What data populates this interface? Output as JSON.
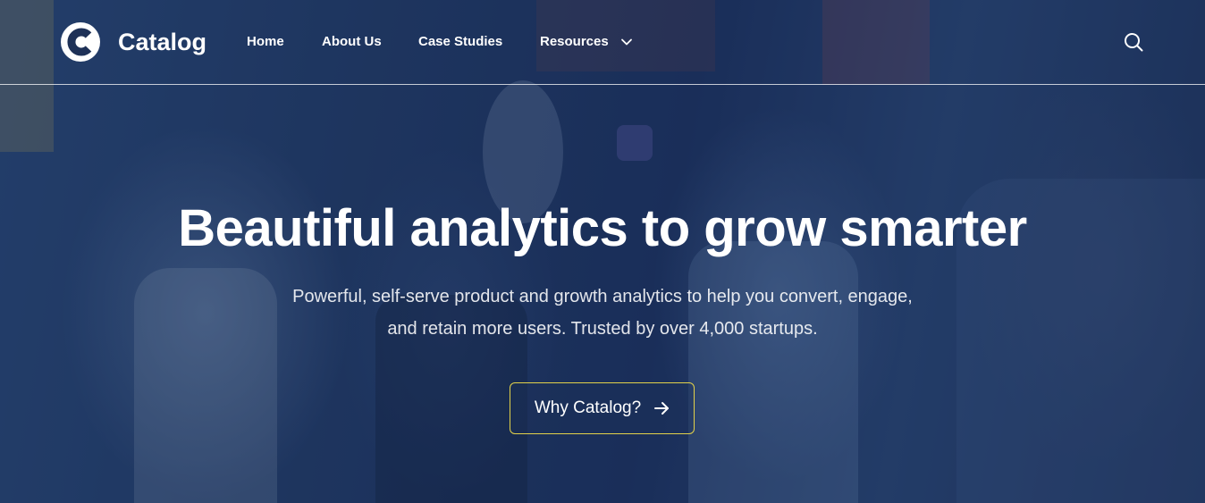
{
  "brand": {
    "name": "Catalog",
    "logo_icon": "catalog-c-logo"
  },
  "nav": {
    "items": [
      {
        "label": "Home"
      },
      {
        "label": "About Us"
      },
      {
        "label": "Case Studies"
      },
      {
        "label": "Resources",
        "has_dropdown": true,
        "icon": "chevron-down-icon"
      }
    ],
    "search_icon": "search-icon"
  },
  "hero": {
    "title": "Beautiful analytics to grow smarter",
    "subtitle_line1": "Powerful, self-serve product and growth analytics to help you convert, engage,",
    "subtitle_line2": "and retain more users. Trusted by over 4,000 startups.",
    "cta_label": "Why Catalog?",
    "cta_icon": "arrow-right-icon"
  },
  "colors": {
    "overlay": "#1e3157",
    "text": "#ffffff",
    "cta_border": "#e3d24a",
    "header_divider": "#ffffff"
  }
}
